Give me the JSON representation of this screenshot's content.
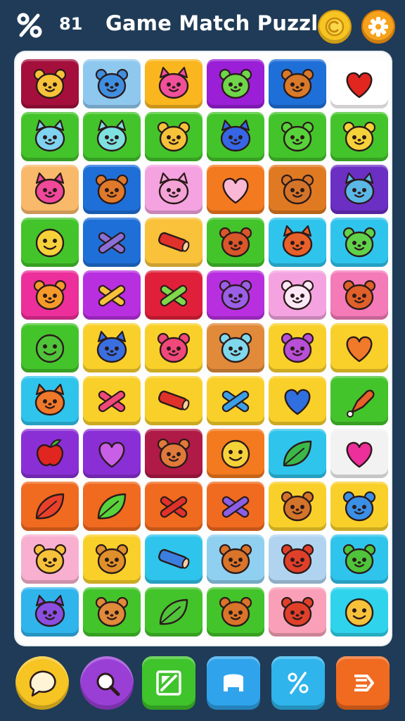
{
  "header": {
    "moves": "81",
    "title": "Game Match Puzzle",
    "icons": [
      "percent-icon",
      "coin-icon",
      "gear-icon"
    ],
    "colors": {
      "background": "#1f3b57",
      "coin": "#f6c423",
      "gear": "#f7a21b"
    }
  },
  "board": {
    "rows": 11,
    "cols": 6,
    "tiles": [
      [
        {
          "c": "#a50f3c",
          "i": "bear",
          "f": "#f6c23a"
        },
        {
          "c": "#8fc8ef",
          "i": "bear",
          "f": "#3f8fe0"
        },
        {
          "c": "#f9b61f",
          "i": "cat",
          "f": "#f0509a"
        },
        {
          "c": "#9a1fd6",
          "i": "bear",
          "f": "#6fd64a"
        },
        {
          "c": "#1f6fd8",
          "i": "bear",
          "f": "#d9792a"
        },
        {
          "c": "#ffffff",
          "i": "heart",
          "f": "#e0261f"
        }
      ],
      [
        {
          "c": "#44c42b",
          "i": "cat",
          "f": "#7fd3f0"
        },
        {
          "c": "#44c42b",
          "i": "cat",
          "f": "#7fe0e0"
        },
        {
          "c": "#44c42b",
          "i": "bear",
          "f": "#f6c23a"
        },
        {
          "c": "#44c42b",
          "i": "cat",
          "f": "#3666e6"
        },
        {
          "c": "#44c42b",
          "i": "bear",
          "f": "#58d23a"
        },
        {
          "c": "#44c42b",
          "i": "bear",
          "f": "#f6d23a"
        }
      ],
      [
        {
          "c": "#f9b96a",
          "i": "cat",
          "f": "#f0489a"
        },
        {
          "c": "#1f6fd8",
          "i": "bear",
          "f": "#e07a2a"
        },
        {
          "c": "#f4a3e0",
          "i": "cat",
          "f": "#f4a3d6"
        },
        {
          "c": "#f47a1f",
          "i": "heart",
          "f": "#f9b8d6"
        },
        {
          "c": "#e07a22",
          "i": "bear",
          "f": "#d3742a"
        },
        {
          "c": "#6b2fc4",
          "i": "cat",
          "f": "#5bb8e6"
        }
      ],
      [
        {
          "c": "#44c42b",
          "i": "smile",
          "f": "#f6d23a"
        },
        {
          "c": "#1f6fd8",
          "i": "sticks",
          "f": "#8a6fd6"
        },
        {
          "c": "#f9c23a",
          "i": "log",
          "f": "#e0322a"
        },
        {
          "c": "#44c42b",
          "i": "bear",
          "f": "#d9562a"
        },
        {
          "c": "#2fc4ec",
          "i": "cat",
          "f": "#e8602a"
        },
        {
          "c": "#2fc4ec",
          "i": "bear",
          "f": "#5fd24a"
        }
      ],
      [
        {
          "c": "#ec2f9a",
          "i": "bear",
          "f": "#f59a2a"
        },
        {
          "c": "#b82fe0",
          "i": "sticks",
          "f": "#f6c23a"
        },
        {
          "c": "#e0203a",
          "i": "sticks",
          "f": "#7fd84a"
        },
        {
          "c": "#b82fe0",
          "i": "bear",
          "f": "#9a5fe6"
        },
        {
          "c": "#f4a3e0",
          "i": "bear",
          "f": "#fbe8f4"
        },
        {
          "c": "#f47ab8",
          "i": "bear",
          "f": "#e0602a"
        }
      ],
      [
        {
          "c": "#44c42b",
          "i": "smile",
          "f": "#4fc43a"
        },
        {
          "c": "#f9d02a",
          "i": "cat",
          "f": "#3a6fe0"
        },
        {
          "c": "#f9d02a",
          "i": "bear",
          "f": "#f0487a"
        },
        {
          "c": "#e08a3a",
          "i": "bear",
          "f": "#7fd8ec"
        },
        {
          "c": "#f9d02a",
          "i": "bear",
          "f": "#b84fd6"
        },
        {
          "c": "#f9d02a",
          "i": "heart",
          "f": "#f07a2a"
        }
      ],
      [
        {
          "c": "#2fc4ec",
          "i": "cat",
          "f": "#f0782a"
        },
        {
          "c": "#f9d02a",
          "i": "sticks",
          "f": "#f0487a"
        },
        {
          "c": "#f9d02a",
          "i": "log",
          "f": "#e0322a"
        },
        {
          "c": "#f9d02a",
          "i": "sticks",
          "f": "#3a9fe6"
        },
        {
          "c": "#f9d02a",
          "i": "heart",
          "f": "#2f6fe0"
        },
        {
          "c": "#44c42b",
          "i": "drum",
          "f": "#e8602a"
        }
      ],
      [
        {
          "c": "#8a2fd6",
          "i": "apple",
          "f": "#e0261f"
        },
        {
          "c": "#8a2fd6",
          "i": "heart",
          "f": "#c85fe6"
        },
        {
          "c": "#b01a46",
          "i": "bear",
          "f": "#e07a3a"
        },
        {
          "c": "#f47a1f",
          "i": "smile",
          "f": "#f6d23a"
        },
        {
          "c": "#2fc4ec",
          "i": "leaf",
          "f": "#3ab84a"
        },
        {
          "c": "#f2f2f2",
          "i": "heart",
          "f": "#ec2f9a"
        }
      ],
      [
        {
          "c": "#f06a1f",
          "i": "leaf",
          "f": "#e8402a"
        },
        {
          "c": "#f06a1f",
          "i": "leaf",
          "f": "#58d23a"
        },
        {
          "c": "#f06a1f",
          "i": "sticks",
          "f": "#e0322a"
        },
        {
          "c": "#f06a1f",
          "i": "sticks",
          "f": "#8a5fe6"
        },
        {
          "c": "#f9d02a",
          "i": "bear",
          "f": "#d3742a"
        },
        {
          "c": "#f9d02a",
          "i": "bear",
          "f": "#3a8fe6"
        }
      ],
      [
        {
          "c": "#f9b0d0",
          "i": "bear",
          "f": "#f6c23a"
        },
        {
          "c": "#f9d02a",
          "i": "bear",
          "f": "#e0902a"
        },
        {
          "c": "#2fc4ec",
          "i": "log",
          "f": "#3a7fe0"
        },
        {
          "c": "#8fd0f0",
          "i": "bear",
          "f": "#d9742a"
        },
        {
          "c": "#b0d4f0",
          "i": "bear",
          "f": "#e0402a"
        },
        {
          "c": "#2fc4ec",
          "i": "bear",
          "f": "#4fc43a"
        }
      ],
      [
        {
          "c": "#2fb4ec",
          "i": "cat",
          "f": "#8a4fe0"
        },
        {
          "c": "#44c42b",
          "i": "bear",
          "f": "#e08a3a"
        },
        {
          "c": "#44c42b",
          "i": "leaf",
          "f": "#4fc43a"
        },
        {
          "c": "#44c42b",
          "i": "bear",
          "f": "#d9742a"
        },
        {
          "c": "#f9a0b8",
          "i": "bear",
          "f": "#e0402a"
        },
        {
          "c": "#2fd4ec",
          "i": "smile",
          "f": "#f6c23a"
        }
      ]
    ]
  },
  "bottom_bar": {
    "buttons": [
      {
        "name": "chat-button",
        "icon": "chat-bubble-icon",
        "color": "#f6c423",
        "shape": "round"
      },
      {
        "name": "search-button",
        "icon": "magnifier-icon",
        "color": "#9a3fd6",
        "shape": "round"
      },
      {
        "name": "edit-button",
        "icon": "pencil-icon",
        "color": "#3fc42b",
        "shape": "sq"
      },
      {
        "name": "inventory-button",
        "icon": "box-icon",
        "color": "#2fa4ec",
        "shape": "sq"
      },
      {
        "name": "discount-button",
        "icon": "percent-icon",
        "color": "#2fb4ec",
        "shape": "sq"
      },
      {
        "name": "menu-button",
        "icon": "menu-lines-icon",
        "color": "#f06a1f",
        "shape": "sq"
      }
    ]
  }
}
